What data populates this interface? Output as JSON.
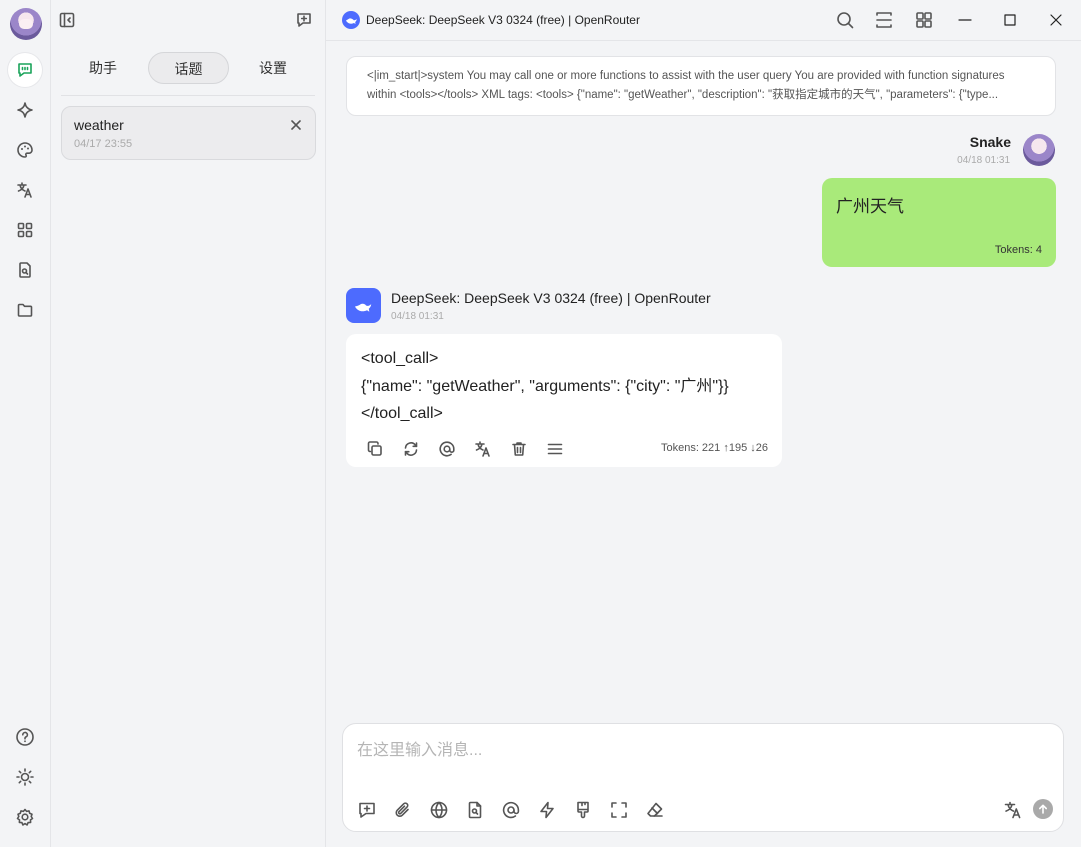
{
  "window": {
    "title": "DeepSeek: DeepSeek V3 0324 (free) | OpenRouter",
    "logo_color": "#4d6bfe"
  },
  "rail": {
    "items": [
      "chat-icon",
      "sparkle-icon",
      "palette-icon",
      "translate-icon",
      "apps-icon",
      "file-search-icon",
      "folder-icon"
    ],
    "bottom": [
      "help-icon",
      "sun-icon",
      "settings-icon"
    ]
  },
  "sidebar": {
    "tabs": [
      {
        "label": "助手"
      },
      {
        "label": "话题"
      },
      {
        "label": "设置"
      }
    ],
    "active_tab": "话题",
    "topics": [
      {
        "title": "weather",
        "time": "04/17 23:55"
      }
    ]
  },
  "chat": {
    "system_prompt": {
      "line1": "<|im_start|>system You may call one or more functions to assist with the user query You are provided with function signatures",
      "line2": "within <tools></tools> XML tags: <tools> {\"name\": \"getWeather\", \"description\": \"获取指定城市的天气\", \"parameters\": {\"type..."
    },
    "messages": [
      {
        "role": "user",
        "name": "Snake",
        "time": "04/18 01:31",
        "text": "广州天气",
        "tokens": "Tokens: 4",
        "bubble_color": "#a9ea7a"
      },
      {
        "role": "assistant",
        "name": "DeepSeek: DeepSeek V3 0324 (free) | OpenRouter",
        "time": "04/18 01:31",
        "text": "<tool_call>\n{\"name\": \"getWeather\", \"arguments\": {\"city\": \"广州\"}}\n</tool_call>",
        "tokens": "Tokens: 221 ↑195 ↓26",
        "actions": [
          "copy-icon",
          "regenerate-icon",
          "mention-icon",
          "translate-icon",
          "delete-icon",
          "menu-icon"
        ]
      }
    ]
  },
  "composer": {
    "placeholder": "在这里输入消息...",
    "value": "",
    "tools": [
      "new-topic-icon",
      "attachment-icon",
      "web-search-icon",
      "knowledge-icon",
      "mention-icon",
      "quick-phrase-icon",
      "brush-icon",
      "fullscreen-icon",
      "clear-icon"
    ],
    "right": [
      "translate-icon",
      "send-icon"
    ]
  }
}
